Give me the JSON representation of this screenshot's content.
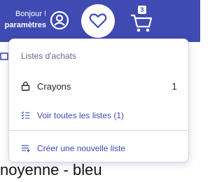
{
  "header": {
    "greeting_line1": "Bonjour !",
    "greeting_line2": "paramètres",
    "cart_count": "3",
    "background_color": "#3f4ab2"
  },
  "dropdown": {
    "title": "Listes d'achats",
    "lists": [
      {
        "name": "Crayons",
        "count": "1",
        "icon": "lock-icon"
      }
    ],
    "view_all_label": "Voir toutes les listes (1)",
    "view_all_icon": "checklist-icon",
    "create_label": "Créer une nouvelle liste",
    "create_icon": "add-list-icon",
    "link_color": "#3f4ab2"
  },
  "background": {
    "product_text_fragment": "noyenne - bleu"
  }
}
